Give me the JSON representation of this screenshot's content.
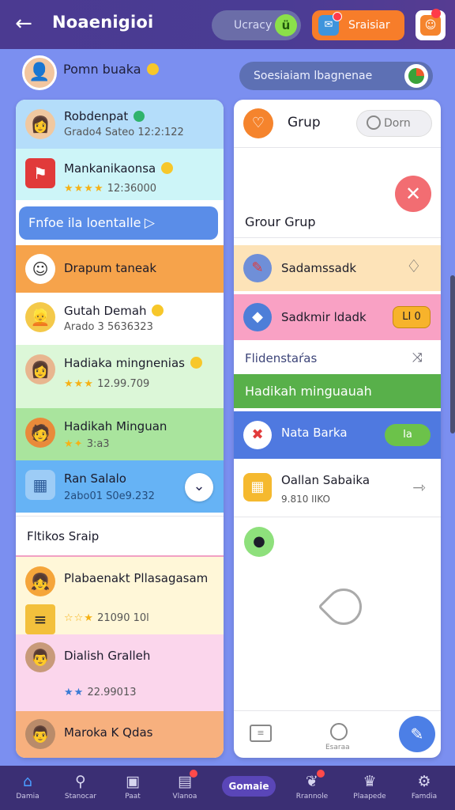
{
  "header": {
    "back_icon": "arrow-left-icon",
    "title": "Noaenigioi",
    "crazy_pill": "Ucracy",
    "streak_label": "Sraisiar"
  },
  "profile": {
    "name": "Pomn buaka",
    "search_label": "Soesiaiam lbagnenae"
  },
  "left_list": {
    "rows": [
      {
        "title": "Robdenpat",
        "subtitle": "Grado4 Sateo 12:2:122",
        "bg": "#b4ddfa"
      },
      {
        "title": "Mankanikaonsa",
        "subtitle": "12:36000",
        "stars": "★★★★",
        "bg": "#cdf5f8"
      },
      {
        "title": "Drapum taneak",
        "bg": "#f6a34b"
      },
      {
        "title": "Gutah Demah",
        "subtitle": "Arado 3 5636323",
        "bg": "#ffffff"
      },
      {
        "title": "Hadiaka mingnenias",
        "subtitle": "12.99.709",
        "stars": "★★★",
        "bg": "#dcf7d8"
      },
      {
        "title": "Hadikah Minguan",
        "subtitle": "3:a3",
        "stars": "★✦",
        "bg": "#a9e49d"
      },
      {
        "title": "Ran Salalo",
        "subtitle": "2abo01 S0e9.232",
        "bg": "#66b3f5"
      },
      {
        "title": "Fltikos Sraip",
        "bg": "#ffffff"
      },
      {
        "title": "Plabaenakt Pllasagasam",
        "subtitle": "21090 10l",
        "stars": "☆☆★",
        "bg": "#fff7d8"
      },
      {
        "title": "Dialish Gralleh",
        "subtitle": "22.99013",
        "stars": "★★",
        "bg": "#fbd6ec"
      },
      {
        "title": "Maroka K Qdas",
        "bg": "#f7b07e"
      }
    ],
    "button_label": "Fnfoe ila loentalle"
  },
  "right_panel": {
    "title": "Grup",
    "search_placeholder": "Dorn",
    "section_title": "Grour Grup",
    "rows": [
      {
        "title": "Sadamssadk",
        "bg": "#fde3b8"
      },
      {
        "title": "Sadkmir ldadk",
        "badge": "LI 0",
        "bg": "#f9a1c4"
      }
    ],
    "fld_title": "Flidenstaŕas",
    "green_bar": "Hadikah minguauah",
    "blue_row": {
      "title": "Nata Barka",
      "badge": "Ia"
    },
    "calendar_row": {
      "title": "Oallan Sabaika",
      "subtitle": "9.810 IIKO"
    },
    "tool_b_label": "Esaraa"
  },
  "bottom_nav": [
    {
      "label": "Damia",
      "icon": "home-icon",
      "active": true
    },
    {
      "label": "Stanocar",
      "icon": "search-icon"
    },
    {
      "label": "Paat",
      "icon": "grid-icon"
    },
    {
      "label": "Vlanoa",
      "icon": "box-icon",
      "badge": true
    },
    {
      "label": "Gomaie",
      "icon": "center-pill"
    },
    {
      "label": "Rrannole",
      "icon": "gift-icon",
      "badge": true
    },
    {
      "label": "Plaapede",
      "icon": "trophy-icon"
    },
    {
      "label": "Famdia",
      "icon": "settings-icon"
    }
  ]
}
